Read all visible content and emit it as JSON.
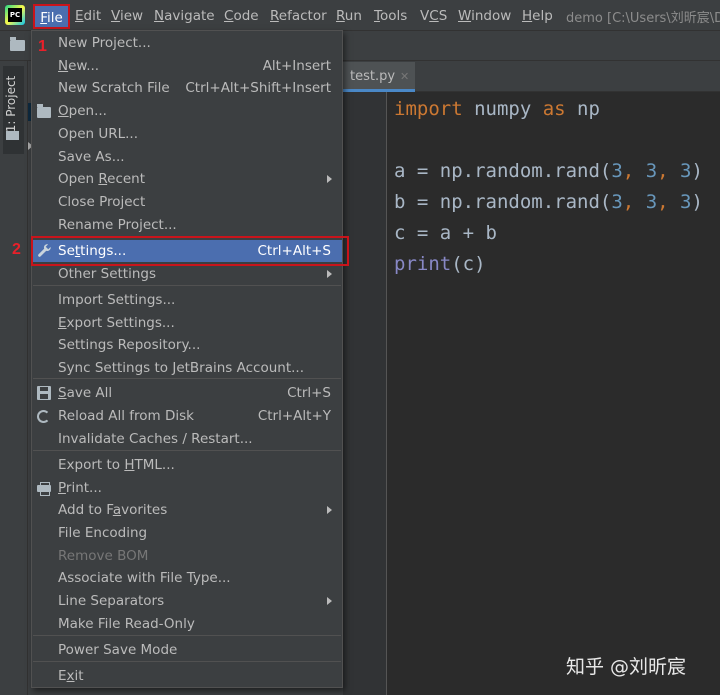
{
  "menubar": {
    "items": [
      {
        "label": "File",
        "mnemonic_index": 0
      },
      {
        "label": "Edit",
        "mnemonic_index": 0
      },
      {
        "label": "View",
        "mnemonic_index": 0
      },
      {
        "label": "Navigate",
        "mnemonic_index": 0
      },
      {
        "label": "Code",
        "mnemonic_index": 0
      },
      {
        "label": "Refactor",
        "mnemonic_index": 0
      },
      {
        "label": "Run",
        "mnemonic_index": 0
      },
      {
        "label": "Tools",
        "mnemonic_index": 0
      },
      {
        "label": "VCS",
        "mnemonic_index": 1
      },
      {
        "label": "Window",
        "mnemonic_index": 0
      },
      {
        "label": "Help",
        "mnemonic_index": 0
      }
    ],
    "window_title": "demo [C:\\Users\\刘昕宸\\De"
  },
  "toolwindow": {
    "project_tab_label": "1: Project"
  },
  "editor": {
    "tab_label": "test.py",
    "tab_close_glyph": "✕",
    "code_lines": [
      [
        {
          "t": "import",
          "c": "kw"
        },
        {
          "t": " numpy ",
          "c": "plain"
        },
        {
          "t": "as",
          "c": "kw"
        },
        {
          "t": " np",
          "c": "plain"
        }
      ],
      [],
      [
        {
          "t": "a = np.random.rand(",
          "c": "plain"
        },
        {
          "t": "3",
          "c": "num"
        },
        {
          "t": ", ",
          "c": "kw"
        },
        {
          "t": "3",
          "c": "num"
        },
        {
          "t": ", ",
          "c": "kw"
        },
        {
          "t": "3",
          "c": "num"
        },
        {
          "t": ")",
          "c": "plain"
        }
      ],
      [
        {
          "t": "b = np.random.rand(",
          "c": "plain"
        },
        {
          "t": "3",
          "c": "num"
        },
        {
          "t": ", ",
          "c": "kw"
        },
        {
          "t": "3",
          "c": "num"
        },
        {
          "t": ", ",
          "c": "kw"
        },
        {
          "t": "3",
          "c": "num"
        },
        {
          "t": ")",
          "c": "plain"
        }
      ],
      [
        {
          "t": "c = a + b",
          "c": "plain"
        }
      ],
      [
        {
          "t": "print",
          "c": "bi"
        },
        {
          "t": "(c)",
          "c": "plain"
        }
      ]
    ]
  },
  "file_menu": {
    "groups": [
      [
        {
          "label": "New Project...",
          "shortcut": "",
          "submenu": false
        },
        {
          "label": "New...",
          "shortcut": "Alt+Insert",
          "submenu": false
        },
        {
          "label": "New Scratch File",
          "shortcut": "Ctrl+Alt+Shift+Insert",
          "submenu": false
        },
        {
          "label": "Open...",
          "shortcut": "",
          "submenu": false,
          "icon": "open-folder-icon"
        },
        {
          "label": "Open URL...",
          "shortcut": "",
          "submenu": false
        },
        {
          "label": "Save As...",
          "shortcut": "",
          "submenu": false
        },
        {
          "label": "Open Recent",
          "shortcut": "",
          "submenu": true
        },
        {
          "label": "Close Project",
          "shortcut": "",
          "submenu": false
        },
        {
          "label": "Rename Project...",
          "shortcut": "",
          "submenu": false
        }
      ],
      [
        {
          "label": "Settings...",
          "shortcut": "Ctrl+Alt+S",
          "submenu": false,
          "icon": "wrench-icon",
          "selected": true
        },
        {
          "label": "Other Settings",
          "shortcut": "",
          "submenu": true
        }
      ],
      [
        {
          "label": "Import Settings...",
          "shortcut": "",
          "submenu": false
        },
        {
          "label": "Export Settings...",
          "shortcut": "",
          "submenu": false
        },
        {
          "label": "Settings Repository...",
          "shortcut": "",
          "submenu": false
        },
        {
          "label": "Sync Settings to JetBrains Account...",
          "shortcut": "",
          "submenu": false
        }
      ],
      [
        {
          "label": "Save All",
          "shortcut": "Ctrl+S",
          "submenu": false,
          "icon": "save-icon"
        },
        {
          "label": "Reload All from Disk",
          "shortcut": "Ctrl+Alt+Y",
          "submenu": false,
          "icon": "reload-icon"
        },
        {
          "label": "Invalidate Caches / Restart...",
          "shortcut": "",
          "submenu": false
        }
      ],
      [
        {
          "label": "Export to HTML...",
          "shortcut": "",
          "submenu": false
        },
        {
          "label": "Print...",
          "shortcut": "",
          "submenu": false,
          "icon": "print-icon"
        },
        {
          "label": "Add to Favorites",
          "shortcut": "",
          "submenu": true
        },
        {
          "label": "File Encoding",
          "shortcut": "",
          "submenu": false
        },
        {
          "label": "Remove BOM",
          "shortcut": "",
          "submenu": false,
          "disabled": true
        },
        {
          "label": "Associate with File Type...",
          "shortcut": "",
          "submenu": false
        },
        {
          "label": "Line Separators",
          "shortcut": "",
          "submenu": true
        },
        {
          "label": "Make File Read-Only",
          "shortcut": "",
          "submenu": false
        }
      ],
      [
        {
          "label": "Power Save Mode",
          "shortcut": "",
          "submenu": false
        }
      ],
      [
        {
          "label": "Exit",
          "shortcut": "",
          "submenu": false
        }
      ]
    ]
  },
  "annotations": {
    "step1": "1",
    "step2": "2"
  },
  "watermark": "知乎 @刘昕宸",
  "colors": {
    "accent": "#4b6eaf",
    "annotation_red": "#c9141b",
    "keyword": "#cc7832",
    "number": "#6897bb",
    "builtin": "#8888c6"
  }
}
